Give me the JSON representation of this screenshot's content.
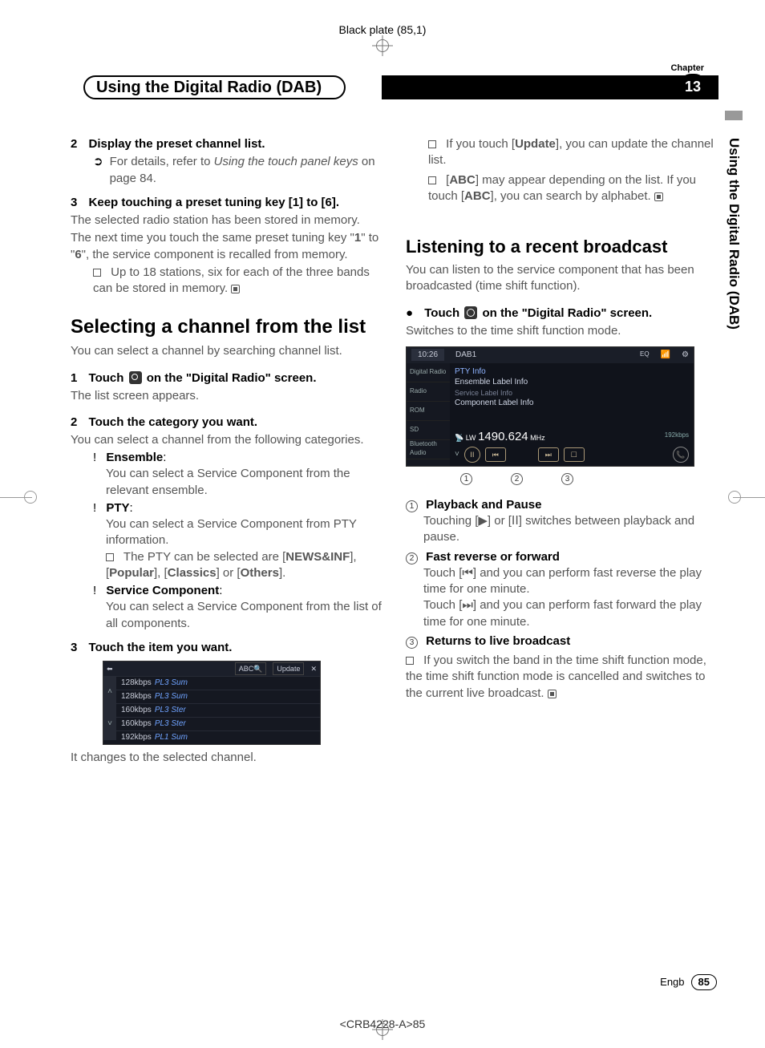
{
  "header_plate": "Black plate (85,1)",
  "chapter": {
    "label": "Chapter",
    "num": "13",
    "title": "Using the Digital Radio (DAB)"
  },
  "side_tab": "Using the Digital Radio (DAB)",
  "left": {
    "step2_num": "2",
    "step2_title": "Display the preset channel list.",
    "step2_detail": "For details, refer to ",
    "step2_detail_ital": "Using the touch panel keys ",
    "step2_detail_end": "on page 84.",
    "step3_num": "3",
    "step3_title": "Keep touching a preset tuning key [1] to [6].",
    "step3_p1": "The selected radio station has been stored in memory.",
    "step3_p2a": "The next time you touch the same preset tuning key \"",
    "step3_p2b": "1",
    "step3_p2c": "\" to \"",
    "step3_p2d": "6",
    "step3_p2e": "\", the service component is recalled from memory.",
    "step3_note": "Up to 18 stations, six for each of the three bands can be stored in memory.",
    "sec1_title": "Selecting a channel from the list",
    "sec1_p": "You can select a channel by searching channel list.",
    "sec1_s1_num": "1",
    "sec1_s1_a": "Touch ",
    "sec1_s1_b": " on the \"Digital Radio\" screen.",
    "sec1_s1_p": "The list screen appears.",
    "sec1_s2_num": "2",
    "sec1_s2_title": "Touch the category you want.",
    "sec1_s2_p": "You can select a channel from the following categories.",
    "cat1_name": "Ensemble",
    "cat1_desc": "You can select a Service Component from the relevant ensemble.",
    "cat2_name": "PTY",
    "cat2_desc": "You can select a Service Component from PTY information.",
    "cat2_note_a": "The PTY can be selected are [",
    "cat2_note_b": "NEWS&INF",
    "cat2_note_c": "], [",
    "cat2_note_d": "Popular",
    "cat2_note_e": "], [",
    "cat2_note_f": "Classics",
    "cat2_note_g": "] or [",
    "cat2_note_h": "Others",
    "cat2_note_i": "].",
    "cat3_name": "Service Component",
    "cat3_desc": "You can select a Service Component from the list of all components.",
    "sec1_s3_num": "3",
    "sec1_s3_title": "Touch the item you want.",
    "sec1_s3_after": "It changes to the selected channel.",
    "list_screenshot": {
      "topbar": {
        "back": "⬅",
        "abc": "ABC🔍",
        "update": "Update",
        "close": "✕"
      },
      "rows": [
        {
          "rate": "128kbps",
          "name": "PL3 Sum"
        },
        {
          "rate": "128kbps",
          "name": "PL3 Sum"
        },
        {
          "rate": "160kbps",
          "name": "PL3 Ster"
        },
        {
          "rate": "160kbps",
          "name": "PL3 Ster"
        },
        {
          "rate": "192kbps",
          "name": "PL1 Sum"
        }
      ]
    }
  },
  "right": {
    "note1_a": "If you touch [",
    "note1_b": "Update",
    "note1_c": "], you can update the channel list.",
    "note2_a": "[",
    "note2_b": "ABC",
    "note2_c": "] may appear depending on the list. If you touch [",
    "note2_d": "ABC",
    "note2_e": "], you can search by alphabet.",
    "sec2_title": "Listening to a recent broadcast",
    "sec2_p": "You can listen to the service component that has been broadcasted (time shift function).",
    "sec2_s_a": "Touch ",
    "sec2_s_b": " on the \"Digital Radio\" screen.",
    "sec2_s_p": "Switches to the time shift function mode.",
    "ts": {
      "time": "10:26",
      "band": "DAB1",
      "eq": "EQ",
      "side": [
        "Digital Radio",
        "Radio",
        "ROM",
        "SD",
        "Bluetooth Audio"
      ],
      "lines": [
        "PTY Info",
        "Ensemble Label Info",
        "Service Label Info",
        "Component Label Info"
      ],
      "freq_pre": "LW ",
      "freq": "1490.624",
      "freq_post": " MHz",
      "rate": "192kbps",
      "btns": [
        "ⅠⅠ",
        "⏮",
        "⏭",
        "☐"
      ],
      "phone": "📞"
    },
    "callouts": [
      "1",
      "2",
      "3"
    ],
    "c1_title": "Playback and Pause",
    "c1_desc": "Touching [▶] or [ⅠⅠ] switches between playback and pause.",
    "c2_title": "Fast reverse or forward",
    "c2_desc1": "Touch [⏮] and you can perform fast reverse the play time for one minute.",
    "c2_desc2": "Touch [⏭] and you can perform fast forward the play time for one minute.",
    "c3_title": "Returns to live broadcast",
    "c_note": "If you switch the band in the time shift function mode, the time shift function mode is cancelled and switches to the current live broadcast."
  },
  "footer": {
    "lang": "Engb",
    "page": "85"
  },
  "doc_code": "<CRB4228-A>85"
}
